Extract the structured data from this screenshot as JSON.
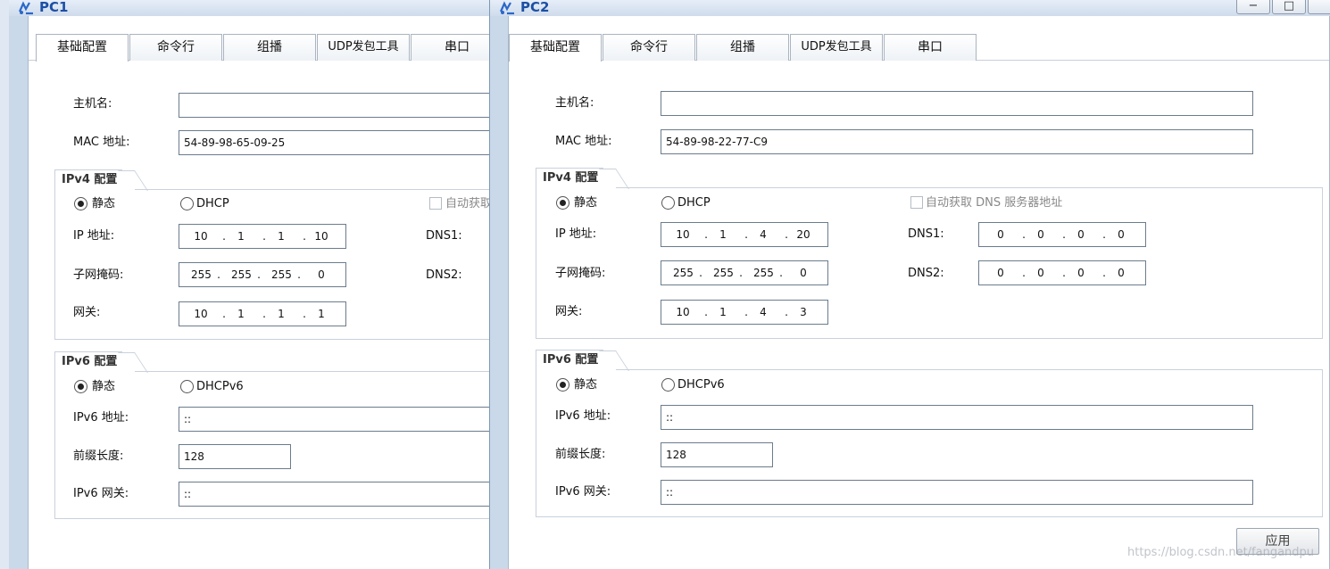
{
  "pc1": {
    "title": "PC1",
    "tabs": [
      "基础配置",
      "命令行",
      "组播",
      "UDP发包工具",
      "串口"
    ],
    "hostname_label": "主机名:",
    "hostname_value": "",
    "mac_label": "MAC 地址:",
    "mac_value": "54-89-98-65-09-25",
    "ipv4": {
      "title": "IPv4 配置",
      "static_label": "静态",
      "dhcp_label": "DHCP",
      "auto_dns_label": "自动获取",
      "ip_label": "IP 地址:",
      "ip": [
        "10",
        "1",
        "1",
        "10"
      ],
      "mask_label": "子网掩码:",
      "mask": [
        "255",
        "255",
        "255",
        "0"
      ],
      "gateway_label": "网关:",
      "gateway": [
        "10",
        "1",
        "1",
        "1"
      ],
      "dns1_label": "DNS1:",
      "dns2_label": "DNS2:"
    },
    "ipv6": {
      "title": "IPv6 配置",
      "static_label": "静态",
      "dhcp_label": "DHCPv6",
      "addr_label": "IPv6 地址:",
      "addr_value": "::",
      "prefix_label": "前缀长度:",
      "prefix_value": "128",
      "gateway_label": "IPv6 网关:",
      "gateway_value": "::"
    }
  },
  "pc2": {
    "title": "PC2",
    "tabs": [
      "基础配置",
      "命令行",
      "组播",
      "UDP发包工具",
      "串口"
    ],
    "hostname_label": "主机名:",
    "hostname_value": "",
    "mac_label": "MAC 地址:",
    "mac_value": "54-89-98-22-77-C9",
    "ipv4": {
      "title": "IPv4 配置",
      "static_label": "静态",
      "dhcp_label": "DHCP",
      "auto_dns_label": "自动获取 DNS 服务器地址",
      "ip_label": "IP 地址:",
      "ip": [
        "10",
        "1",
        "4",
        "20"
      ],
      "mask_label": "子网掩码:",
      "mask": [
        "255",
        "255",
        "255",
        "0"
      ],
      "gateway_label": "网关:",
      "gateway": [
        "10",
        "1",
        "4",
        "3"
      ],
      "dns1_label": "DNS1:",
      "dns1": [
        "0",
        "0",
        "0",
        "0"
      ],
      "dns2_label": "DNS2:",
      "dns2": [
        "0",
        "0",
        "0",
        "0"
      ]
    },
    "ipv6": {
      "title": "IPv6 配置",
      "static_label": "静态",
      "dhcp_label": "DHCPv6",
      "addr_label": "IPv6 地址:",
      "addr_value": "::",
      "prefix_label": "前缀长度:",
      "prefix_value": "128",
      "gateway_label": "IPv6 网关:",
      "gateway_value": "::"
    },
    "apply_label": "应用"
  },
  "window_controls": {
    "minimize": "−",
    "maximize": "□"
  },
  "watermark": "https://blog.csdn.net/fangandpu",
  "icons": {
    "app": "network-pc-icon"
  },
  "colors": {
    "title_text": "#1c4fa5",
    "window_bg": "#c9d9ea",
    "panel_bg": "#ffffff"
  }
}
